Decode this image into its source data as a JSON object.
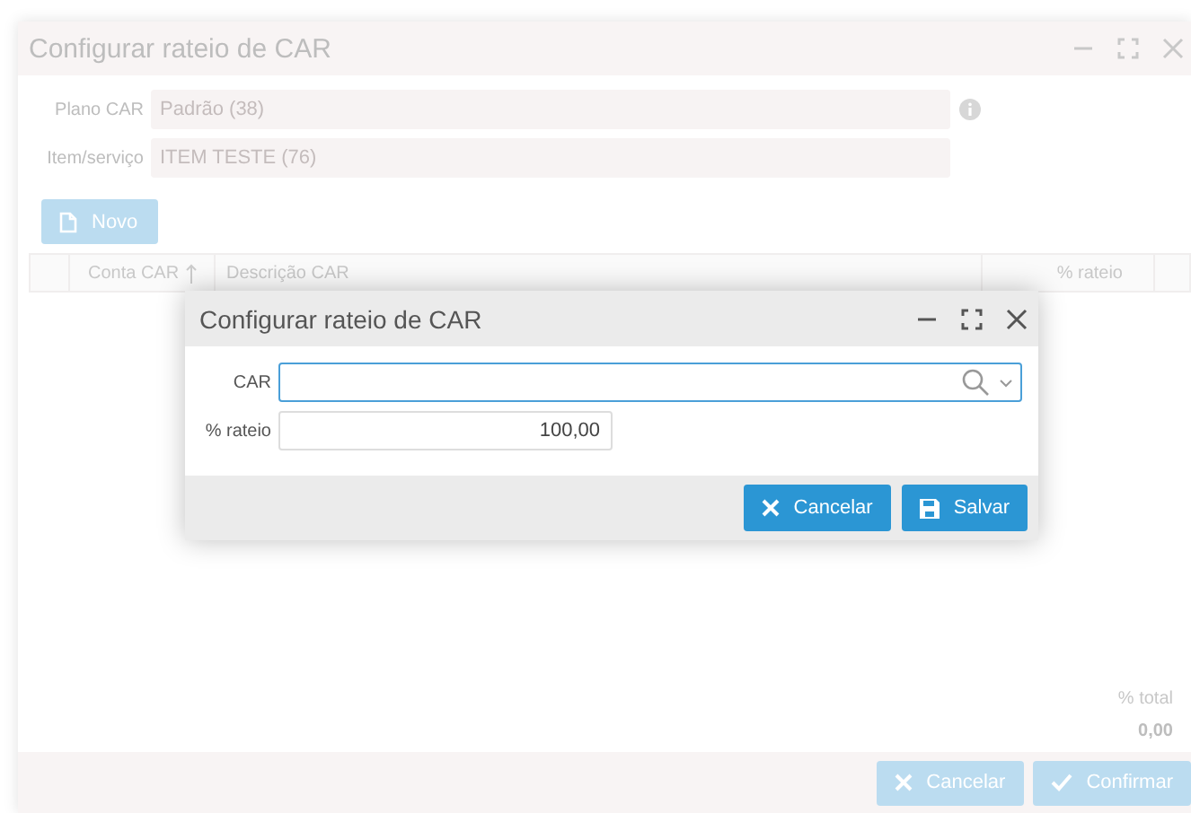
{
  "window": {
    "title": "Configurar rateio de CAR"
  },
  "fields": [
    {
      "label": "Plano CAR",
      "value": "Padrão (38)",
      "info": true
    },
    {
      "label": "Item/serviço",
      "value": "ITEM TESTE (76)",
      "info": false
    }
  ],
  "new_button": {
    "label": "Novo"
  },
  "table": {
    "columns": [
      {
        "kind": "check"
      },
      {
        "label": "Conta CAR",
        "kind": "text",
        "sorted": true
      },
      {
        "label": "Descrição CAR",
        "kind": "text",
        "sorted": false
      },
      {
        "label": "% rateio",
        "kind": "number",
        "sorted": false
      },
      {
        "kind": "extra"
      }
    ]
  },
  "total": {
    "label": "% total",
    "value": "0,00"
  },
  "buttons": [
    {
      "label": "Cancelar",
      "kind": "cancel"
    },
    {
      "label": "Confirmar",
      "kind": "confirm"
    }
  ],
  "dialog": {
    "title": "Configurar rateio de CAR",
    "fields": [
      {
        "label": "CAR",
        "kind": "lookup",
        "focused": true
      },
      {
        "label": "% rateio",
        "kind": "number",
        "value": "100,00",
        "focused": false
      }
    ],
    "buttons": [
      {
        "label": "Cancelar",
        "kind": "cancel"
      },
      {
        "label": "Salvar",
        "kind": "save"
      }
    ]
  }
}
